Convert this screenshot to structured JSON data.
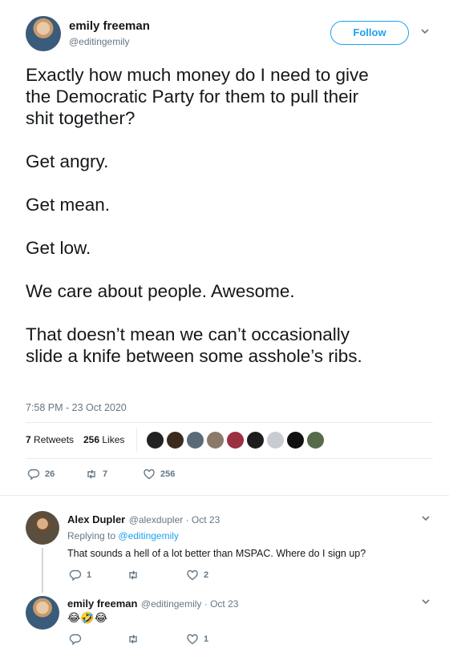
{
  "author": {
    "name": "emily freeman",
    "handle": "@editingemily",
    "follow_label": "Follow"
  },
  "tweet": {
    "lines": [
      "Exactly how much money do I need to give",
      "the Democratic Party for them to pull their",
      "shit together?",
      "Get angry.",
      "Get mean.",
      "Get low.",
      "We care about people. Awesome.",
      "That doesn’t mean we can’t occasionally",
      "slide a knife between some asshole’s ribs."
    ],
    "timestamp": "7:58 PM - 23 Oct 2020"
  },
  "stats": {
    "retweets_count": "7",
    "retweets_label": "Retweets",
    "likes_count": "256",
    "likes_label": "Likes"
  },
  "actions": {
    "reply_count": "26",
    "retweet_count": "7",
    "like_count": "256"
  },
  "replies": [
    {
      "name": "Alex Dupler",
      "meta": "@alexdupler · Oct 23",
      "replying_prefix": "Replying to",
      "replying_handle": "@editingemily",
      "text": "That sounds a hell of a lot better than MSPAC. Where do I sign up?",
      "reply_count": "1",
      "retweet_count": "",
      "like_count": "2"
    },
    {
      "name": "emily freeman",
      "meta": "@editingemily · Oct 23",
      "text": "😂🤣😂",
      "reply_count": "",
      "retweet_count": "",
      "like_count": "1"
    }
  ],
  "colors": {
    "accent": "#1da1f2",
    "muted": "#657786",
    "text": "#14171a",
    "divider": "#e6ecf0"
  }
}
